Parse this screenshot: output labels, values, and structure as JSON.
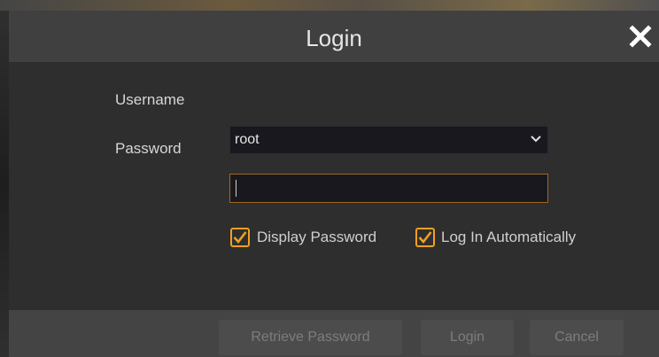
{
  "dialog": {
    "title": "Login",
    "close_icon": "close-icon"
  },
  "form": {
    "username": {
      "label": "Username",
      "value": "root",
      "dropdown_icon": "chevron-down-icon"
    },
    "password": {
      "label": "Password",
      "value": ""
    },
    "options": [
      {
        "label": "Display Password",
        "checked": true
      },
      {
        "label": "Log In Automatically",
        "checked": true
      }
    ]
  },
  "footer": {
    "retrieve_label": "Retrieve Password",
    "login_label": "Login",
    "cancel_label": "Cancel"
  },
  "colors": {
    "accent": "#f0a020",
    "dialog_bg": "#343434",
    "title_bg": "#404040",
    "input_bg": "#19181e",
    "footer_bg": "#444444"
  }
}
